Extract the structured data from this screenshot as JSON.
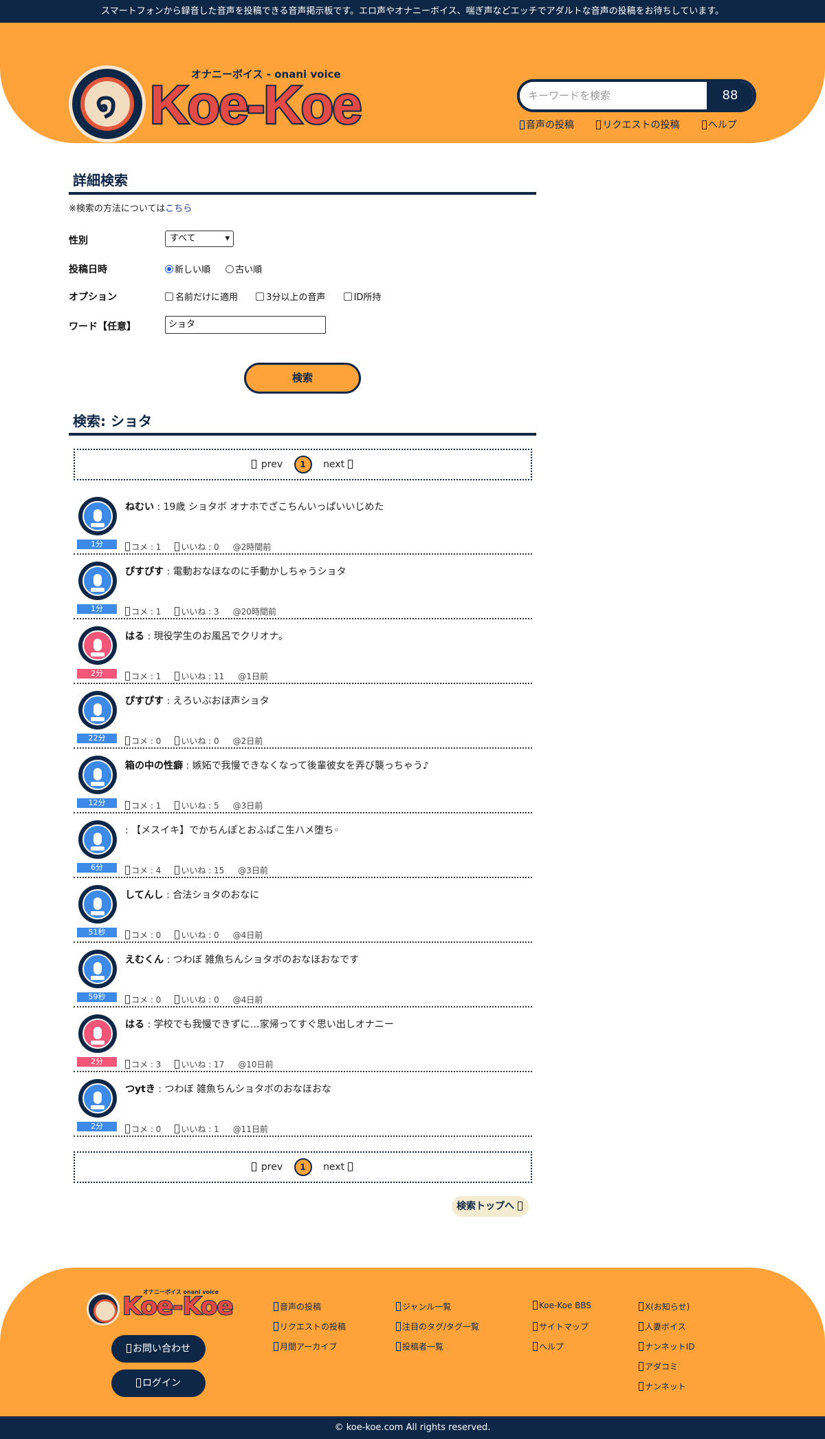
{
  "topbar": {
    "text": "スマートフォンから録音した音声を投稿できる音声掲示板です。エロ声やオナニーボイス、喘ぎ声などエッチでアダルトな音声の投稿をお待ちしています。"
  },
  "header": {
    "logo_sub": "オナニーボイス - onani voice",
    "logo_main": "Koe-Koe",
    "search": {
      "placeholder": "キーワードを検索",
      "button_icon": "search-grid-icon",
      "button_glyph": "88"
    },
    "nav": [
      "音声の投稿",
      "リクエストの投稿",
      "ヘルプ"
    ]
  },
  "detail_search": {
    "title": "詳細検索",
    "note": "※検索の方法については",
    "note_link": "こちら",
    "gender": {
      "label": "性別",
      "selected": "すべて"
    },
    "date": {
      "label": "投稿日時",
      "options": [
        "新しい順",
        "古い順"
      ],
      "selected": "新しい順"
    },
    "options": {
      "label": "オプション",
      "items": [
        "名前だけに適用",
        "3分以上の音声",
        "ID所持"
      ]
    },
    "word": {
      "label": "ワード【任意】",
      "value": "ショタ"
    },
    "submit": "検索"
  },
  "results": {
    "title": "検索: ショタ",
    "pager": {
      "prev": "prev",
      "current": "1",
      "next": "next"
    },
    "items": [
      {
        "user": "ねむい",
        "text": "19歳 ショタボ オナホでざこちんいっぱいいじめた",
        "duration": "1分",
        "gender": "male",
        "comments": "コメ : 1",
        "likes": "いいね : 0",
        "time": "@2時間前"
      },
      {
        "user": "ぴすぴす",
        "text": "電動おなほなのに手動かしちゃうショタ",
        "duration": "1分",
        "gender": "male",
        "comments": "コメ : 1",
        "likes": "いいね : 3",
        "time": "@20時間前"
      },
      {
        "user": "はる",
        "text": "現役学生のお風呂でクリオナ。",
        "duration": "2分",
        "gender": "female",
        "comments": "コメ : 1",
        "likes": "いいね : 11",
        "time": "@1日前"
      },
      {
        "user": "ぴすぴす",
        "text": "えろいぶおほ声ショタ",
        "duration": "22分",
        "gender": "male",
        "comments": "コメ : 0",
        "likes": "いいね : 0",
        "time": "@2日前"
      },
      {
        "user": "箱の中の性癖",
        "text": "嫉妬で我慢できなくなって後輩彼女を弄び襲っちゃう♪",
        "duration": "12分",
        "gender": "male",
        "comments": "コメ : 1",
        "likes": "いいね : 5",
        "time": "@3日前"
      },
      {
        "user": "",
        "text": "【メスイキ】でかちんぽとおふぱこ生ハメ堕ち◦",
        "duration": "6分",
        "gender": "male",
        "comments": "コメ : 4",
        "likes": "いいね : 15",
        "time": "@3日前"
      },
      {
        "user": "してんし",
        "text": "合法ショタのおなに",
        "duration": "51秒",
        "gender": "male",
        "comments": "コメ : 0",
        "likes": "いいね : 0",
        "time": "@4日前"
      },
      {
        "user": "えむくん",
        "text": "つわぼ 雑魚ちんショタボのおなほおなです",
        "duration": "59秒",
        "gender": "male",
        "comments": "コメ : 0",
        "likes": "いいね : 0",
        "time": "@4日前"
      },
      {
        "user": "はる",
        "text": "学校でも我慢できずに…家帰ってすぐ思い出しオナニー",
        "duration": "2分",
        "gender": "female",
        "comments": "コメ : 3",
        "likes": "いいね : 17",
        "time": "@10日前"
      },
      {
        "user": "つytき",
        "text": "つわぼ 雑魚ちんショタボのおなほおな",
        "duration": "2分",
        "gender": "male",
        "comments": "コメ : 0",
        "likes": "いいね : 1",
        "time": "@11日前"
      }
    ],
    "back_to_top": "検索トップへ"
  },
  "footer": {
    "logo_sub": "オナニーボイス onani voice",
    "logo_main": "Koe-Koe",
    "contact": "お問い合わせ",
    "login": "ログイン",
    "col1": [
      "音声の投稿",
      "リクエストの投稿",
      "月間アーカイブ"
    ],
    "col2": [
      "ジャンル一覧",
      "注目のタグ/タグ一覧",
      "投稿者一覧"
    ],
    "col3": [
      "Koe-Koe BBS",
      "サイトマップ",
      "ヘルプ"
    ],
    "col4": [
      "X(お知らせ)",
      "人妻ボイス",
      "ナンネットID",
      "アダコミ",
      "ナンネット"
    ],
    "copyright": "© koe-koe.com All rights reserved."
  },
  "colors": {
    "brand_orange": "#fda33a",
    "navy": "#0f2747",
    "male": "#3d8ae8",
    "female": "#f2577a"
  }
}
